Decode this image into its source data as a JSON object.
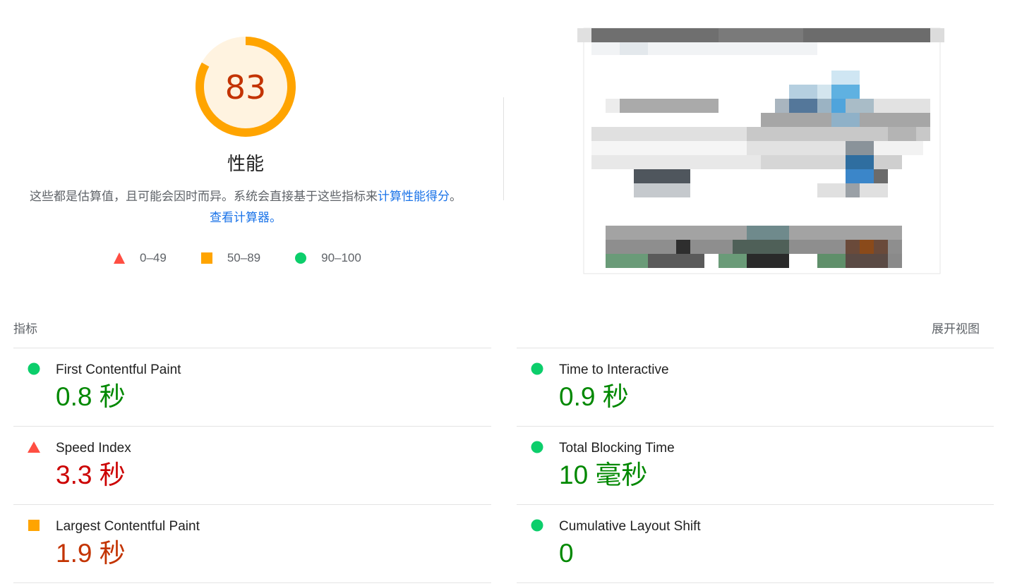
{
  "gauge": {
    "score": "83",
    "score_fraction": 0.83,
    "title": "性能",
    "color": "#ffa400",
    "track_color": "#fff3e0",
    "text_color": "#c33300"
  },
  "description": {
    "text": "这些都是估算值，且可能会因时而异。系统会直接基于这些指标来",
    "link1": "计算性能得分",
    "separator": "。",
    "link2": "查看计算器。"
  },
  "legend": [
    {
      "shape": "triangle-icon",
      "color": "#ff4e42",
      "label": "0–49"
    },
    {
      "shape": "square-icon",
      "color": "#ffa400",
      "label": "50–89"
    },
    {
      "shape": "circle-icon",
      "color": "#0cce6b",
      "label": "90–100"
    }
  ],
  "metrics_header": "指标",
  "expand_label": "展开视图",
  "metrics": [
    {
      "name": "First Contentful Paint",
      "value": "0.8 秒",
      "status": "pass",
      "icon": "circle-icon",
      "color": "#0cce6b",
      "value_color": "#008800"
    },
    {
      "name": "Time to Interactive",
      "value": "0.9 秒",
      "status": "pass",
      "icon": "circle-icon",
      "color": "#0cce6b",
      "value_color": "#008800"
    },
    {
      "name": "Speed Index",
      "value": "3.3 秒",
      "status": "fail",
      "icon": "triangle-icon",
      "color": "#ff4e42",
      "value_color": "#cc0000"
    },
    {
      "name": "Total Blocking Time",
      "value": "10 毫秒",
      "status": "pass",
      "icon": "circle-icon",
      "color": "#0cce6b",
      "value_color": "#008800"
    },
    {
      "name": "Largest Contentful Paint",
      "value": "1.9 秒",
      "status": "average",
      "icon": "square-icon",
      "color": "#ffa400",
      "value_color": "#c33300"
    },
    {
      "name": "Cumulative Layout Shift",
      "value": "0",
      "status": "pass",
      "icon": "circle-icon",
      "color": "#0cce6b",
      "value_color": "#008800"
    }
  ]
}
